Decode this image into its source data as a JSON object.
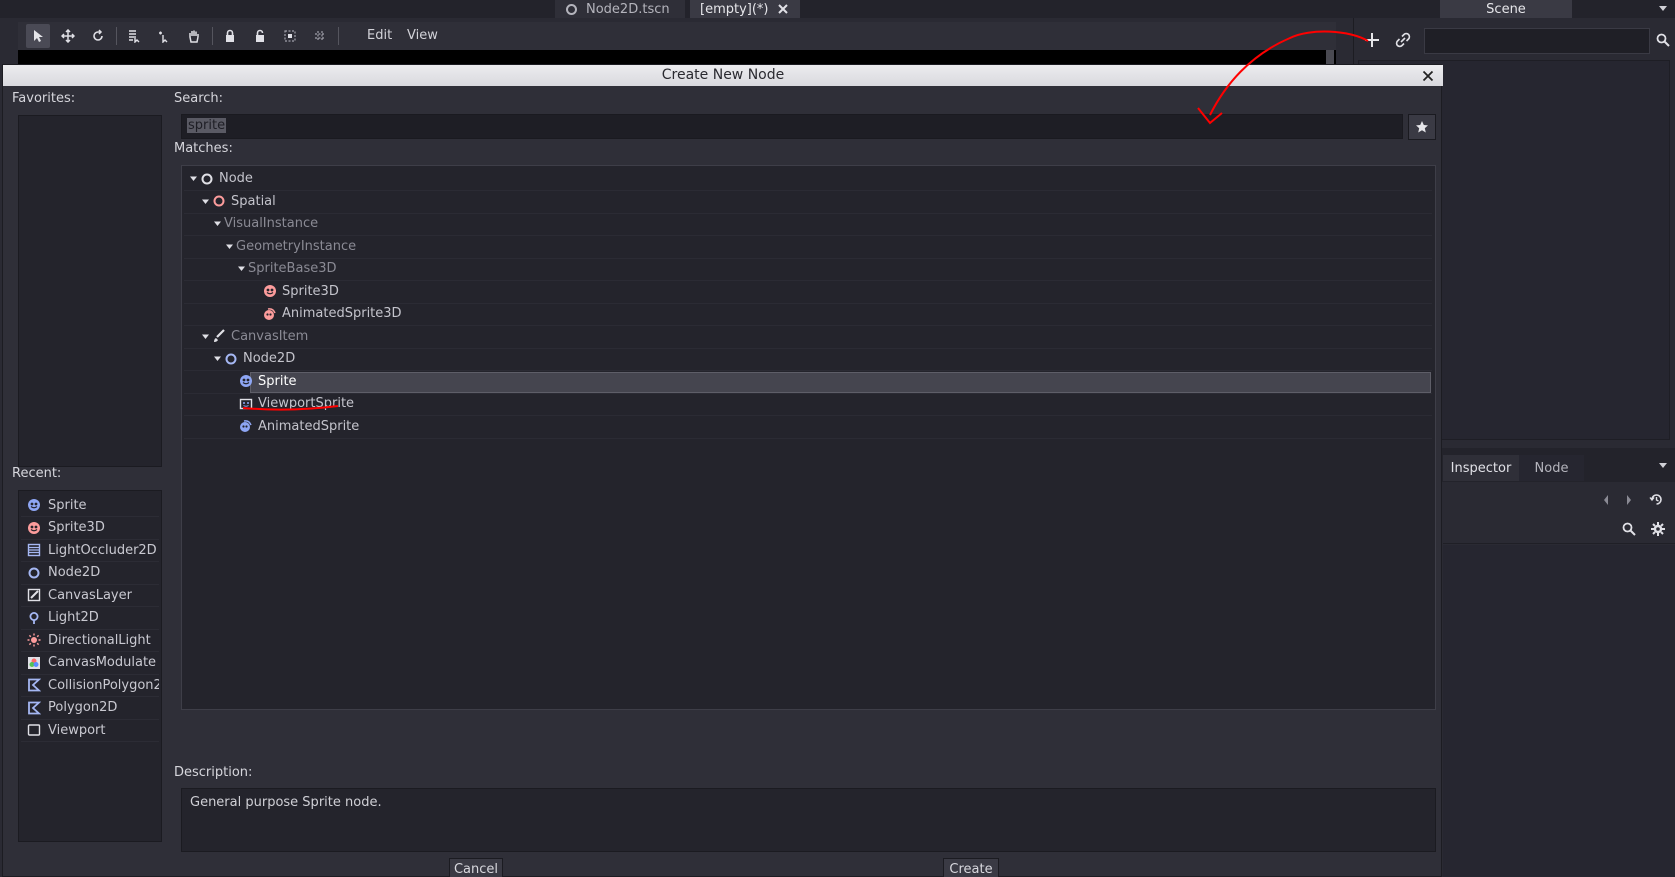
{
  "editor": {
    "scene_tabs": [
      {
        "label": "Node2D.tscn",
        "icon": "node2d-icon"
      },
      {
        "label": "[empty](*)",
        "icon": "close-icon"
      }
    ],
    "toolbar": {
      "menus": [
        "Edit",
        "View"
      ],
      "tools": [
        "select-icon",
        "move-icon",
        "rotate-icon",
        "list-select-icon",
        "pivot-icon",
        "pan-icon",
        "lock-icon",
        "unlock-icon",
        "group-icon",
        "ungroup-icon"
      ]
    }
  },
  "right_dock": {
    "scene_tab": "Scene",
    "inspector_tabs": [
      "Inspector",
      "Node"
    ],
    "scene_toolbar_icons": [
      "add-node-icon",
      "link-icon",
      "search-icon"
    ]
  },
  "dialog": {
    "title": "Create New Node",
    "favorites_label": "Favorites:",
    "recent_label": "Recent:",
    "search_label": "Search:",
    "search_value": "sprite",
    "matches_label": "Matches:",
    "description_label": "Description:",
    "description": "General purpose Sprite node.",
    "cancel_label": "Cancel",
    "create_label": "Create",
    "recent": [
      {
        "label": "Sprite",
        "icon": "sprite-icon",
        "color": "#8ea6f4"
      },
      {
        "label": "Sprite3D",
        "icon": "sprite3d-icon",
        "color": "#fc9c9c"
      },
      {
        "label": "LightOccluder2D",
        "icon": "light-occluder-icon",
        "color": "#a5b7f3"
      },
      {
        "label": "Node2D",
        "icon": "node2d-icon",
        "color": "#a5b7f3"
      },
      {
        "label": "CanvasLayer",
        "icon": "canvas-layer-icon",
        "color": "#e0e0e0"
      },
      {
        "label": "Light2D",
        "icon": "light2d-icon",
        "color": "#a5b7f3"
      },
      {
        "label": "DirectionalLight",
        "icon": "directional-light-icon",
        "color": "#fc9c9c"
      },
      {
        "label": "CanvasModulate",
        "icon": "canvas-modulate-icon",
        "color": "#a5b7f3"
      },
      {
        "label": "CollisionPolygon2",
        "icon": "collision-polygon-icon",
        "color": "#a5b7f3"
      },
      {
        "label": "Polygon2D",
        "icon": "polygon2d-icon",
        "color": "#a5b7f3"
      },
      {
        "label": "Viewport",
        "icon": "viewport-icon",
        "color": "#e0e0e0"
      }
    ],
    "matches": [
      {
        "label": "Node",
        "depth": 0,
        "icon": "node-icon",
        "dim": false,
        "expand": true
      },
      {
        "label": "Spatial",
        "depth": 1,
        "icon": "spatial-icon",
        "dim": false,
        "expand": true
      },
      {
        "label": "VisualInstance",
        "depth": 2,
        "icon": "",
        "dim": true,
        "expand": true
      },
      {
        "label": "GeometryInstance",
        "depth": 3,
        "icon": "",
        "dim": true,
        "expand": true
      },
      {
        "label": "SpriteBase3D",
        "depth": 4,
        "icon": "",
        "dim": true,
        "expand": true
      },
      {
        "label": "Sprite3D",
        "depth": 5,
        "icon": "sprite3d-icon",
        "dim": false,
        "expand": false
      },
      {
        "label": "AnimatedSprite3D",
        "depth": 5,
        "icon": "animated-sprite3d-icon",
        "dim": false,
        "expand": false
      },
      {
        "label": "CanvasItem",
        "depth": 1,
        "icon": "canvas-item-icon",
        "dim": true,
        "expand": true
      },
      {
        "label": "Node2D",
        "depth": 2,
        "icon": "node2d-icon",
        "dim": false,
        "expand": true
      },
      {
        "label": "Sprite",
        "depth": 3,
        "icon": "sprite-icon",
        "dim": false,
        "expand": false,
        "selected": true
      },
      {
        "label": "ViewportSprite",
        "depth": 3,
        "icon": "viewport-sprite-icon",
        "dim": false,
        "expand": false
      },
      {
        "label": "AnimatedSprite",
        "depth": 3,
        "icon": "animated-sprite-icon",
        "dim": false,
        "expand": false
      }
    ]
  },
  "annotation": {
    "color": "#ff0000"
  }
}
